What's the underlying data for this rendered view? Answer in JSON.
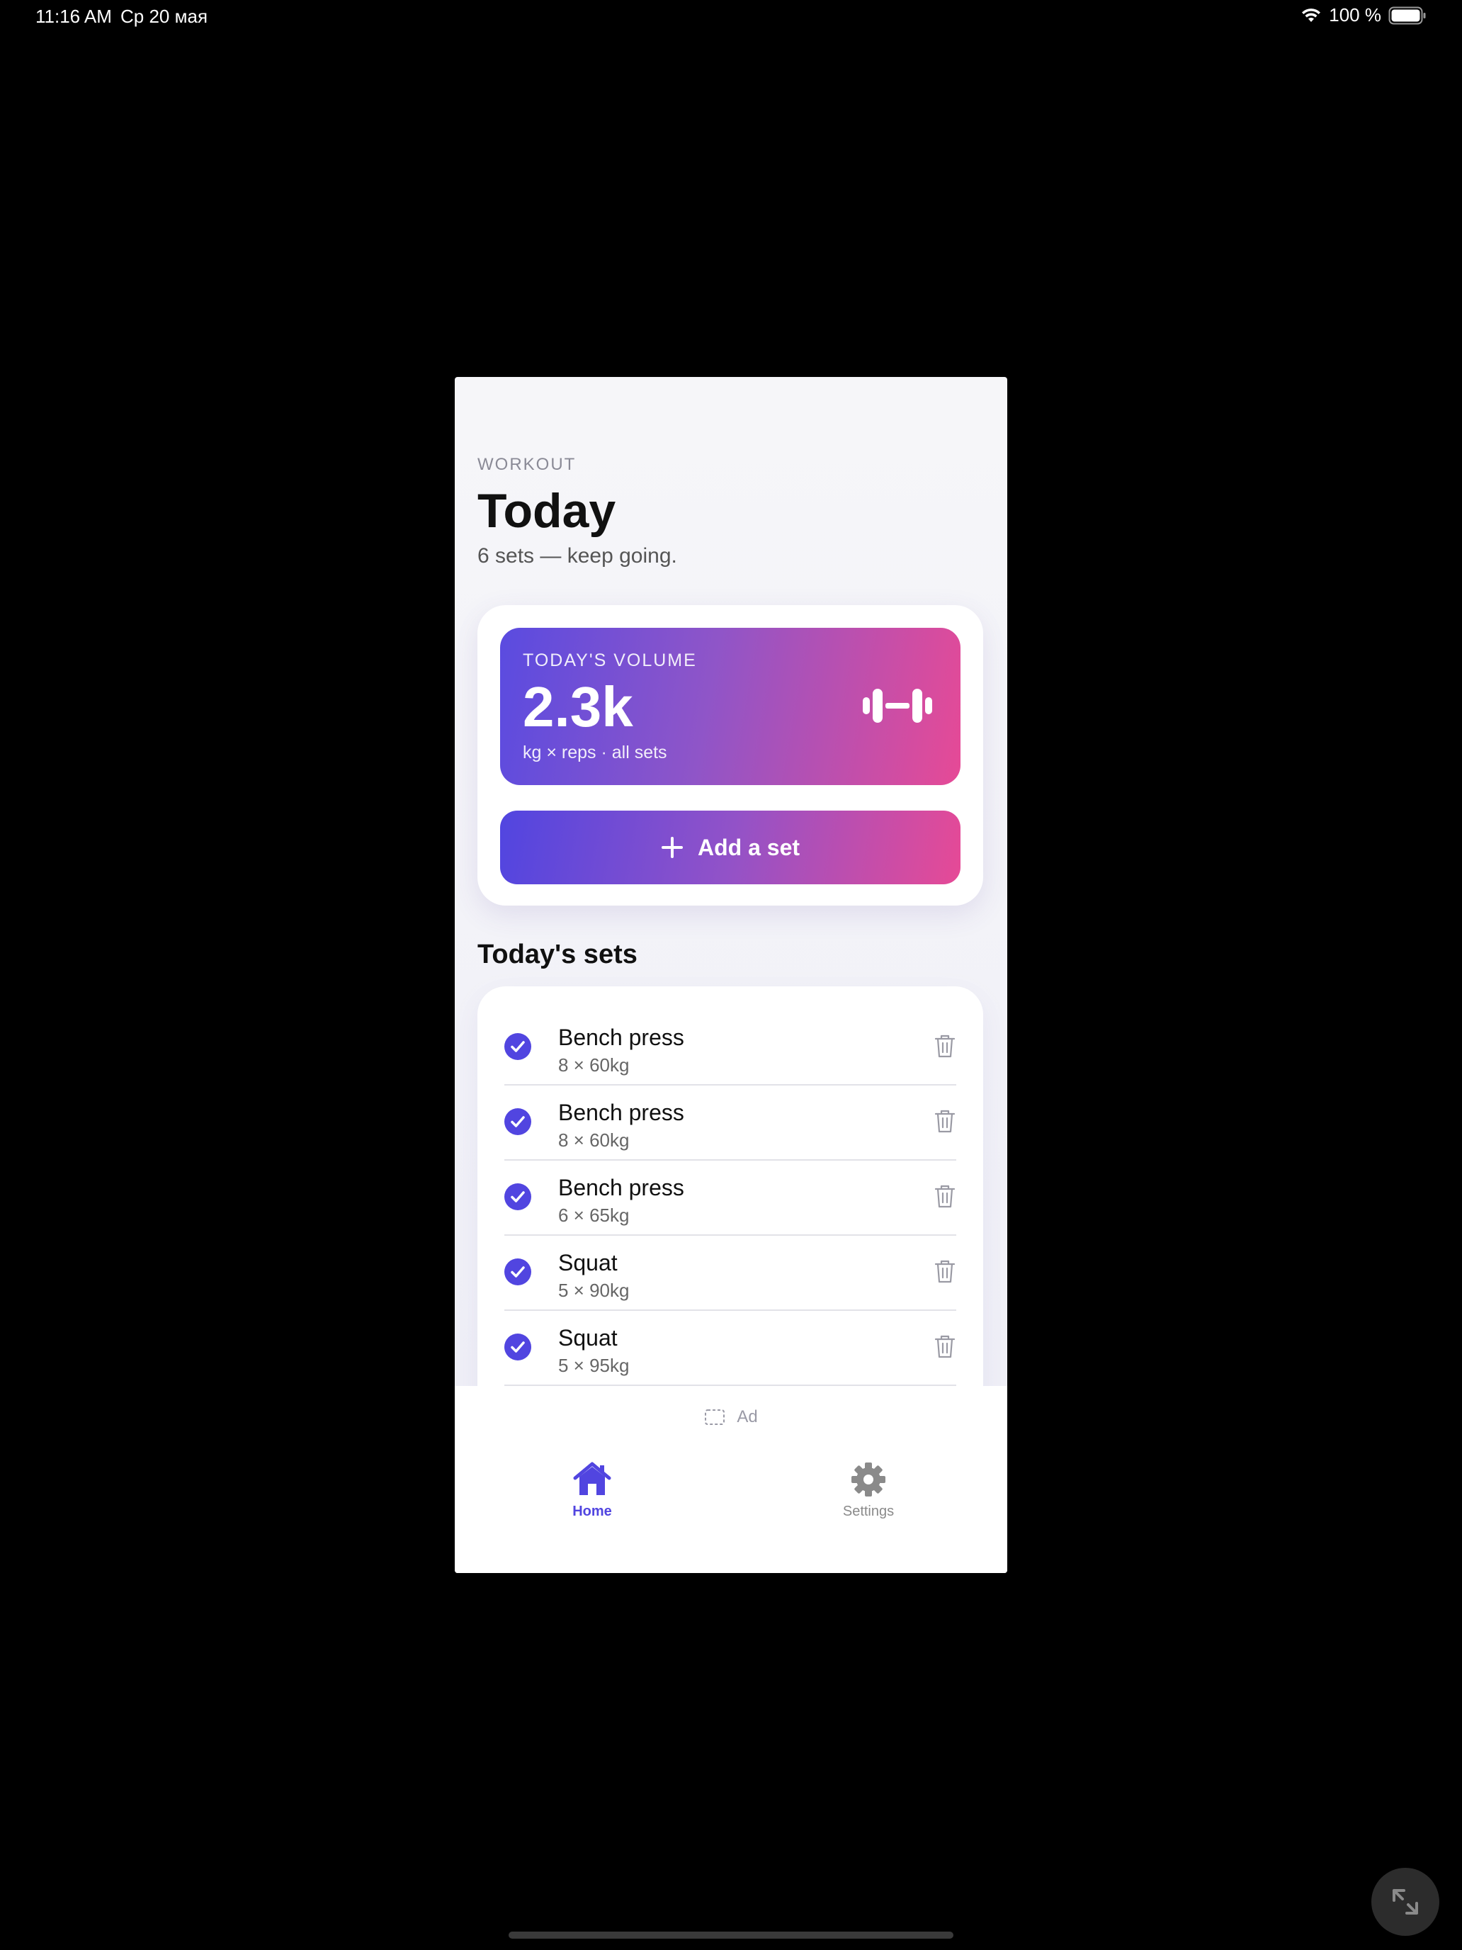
{
  "status_bar": {
    "time": "11:16 AM",
    "date": "Ср 20 мая",
    "battery": "100 %"
  },
  "header": {
    "eyebrow": "WORKOUT",
    "title": "Today",
    "subtitle": "6 sets — keep going."
  },
  "volume": {
    "label": "TODAY'S VOLUME",
    "value": "2.3k",
    "caption": "kg × reps · all sets"
  },
  "add_set_label": "Add a set",
  "sets_section_title": "Today's sets",
  "sets": [
    {
      "name": "Bench press",
      "detail": "8 × 60kg"
    },
    {
      "name": "Bench press",
      "detail": "8 × 60kg"
    },
    {
      "name": "Bench press",
      "detail": "6 × 65kg"
    },
    {
      "name": "Squat",
      "detail": "5 × 90kg"
    },
    {
      "name": "Squat",
      "detail": "5 × 95kg"
    }
  ],
  "ad_label": "Ad",
  "tabs": [
    {
      "label": "Home",
      "icon": "home-icon",
      "active": true
    },
    {
      "label": "Settings",
      "icon": "gear-icon",
      "active": false
    }
  ],
  "colors": {
    "accent": "#5145e0",
    "gradient_start": "#5a4be0",
    "gradient_end": "#e64a96"
  }
}
